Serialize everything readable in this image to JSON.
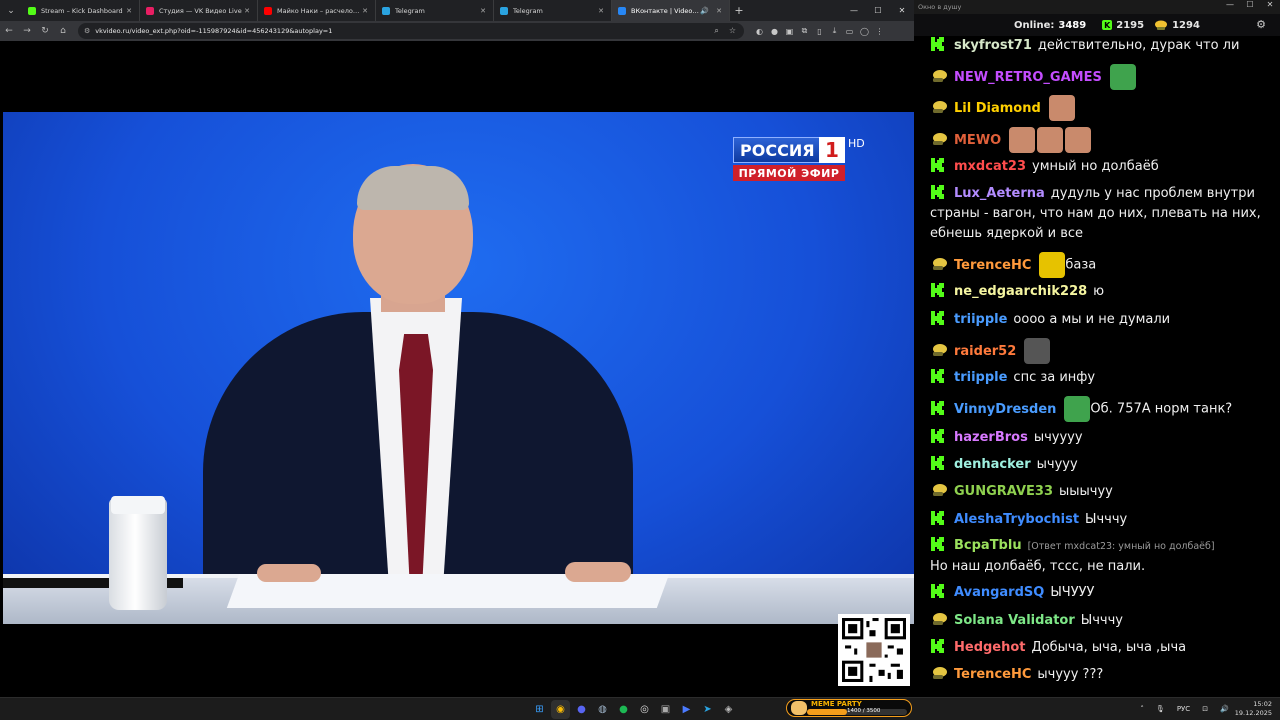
{
  "tabs": [
    {
      "title": "Stream – Kick Dashboard",
      "color": "#53fc18",
      "active": false
    },
    {
      "title": "Студия — VK Видео Live",
      "color": "#e91e63",
      "active": false
    },
    {
      "title": "Майко Наки – расчеловечиваю",
      "color": "#ff0000",
      "active": false
    },
    {
      "title": "Telegram",
      "color": "#2aa3e0",
      "active": false
    },
    {
      "title": "Telegram",
      "color": "#2aa3e0",
      "active": false
    },
    {
      "title": "ВКонтакте | Video Ext",
      "color": "#2787f5",
      "active": true
    }
  ],
  "address_bar": {
    "url": "vkvideo.ru/video_ext.php?oid=-115987924&id=456243129&autoplay=1"
  },
  "video": {
    "channel_name": "РОССИЯ",
    "channel_number": "1",
    "channel_hd": "HD",
    "live_label": "ПРЯМОЙ ЭФИР"
  },
  "chat": {
    "window_title": "Окно в душу",
    "online_label": "Online:",
    "online_count": "3489",
    "kick_count": "2195",
    "vk_count": "1294",
    "messages": [
      {
        "platform": "kick",
        "user": "skyfrost71",
        "color": "#d7e8c9",
        "text": "действительно, дурак что ли",
        "emotes": []
      },
      {
        "platform": "vk",
        "user": "NEW_RETRO_GAMES",
        "color": "#c44dff",
        "text": "",
        "emotes": [
          "pepe"
        ]
      },
      {
        "platform": "vk",
        "user": "Lil Diamond",
        "color": "#ffd000",
        "text": "",
        "emotes": [
          "face"
        ]
      },
      {
        "platform": "vk",
        "user": "MEWO",
        "color": "#e0603a",
        "text": "",
        "emotes": [
          "face",
          "face",
          "face"
        ]
      },
      {
        "platform": "kick",
        "user": "mxdcat23",
        "color": "#ff4d4d",
        "text": "умный но долбаёб",
        "emotes": []
      },
      {
        "platform": "kick",
        "user": "Lux_Aeterna",
        "color": "#b38cff",
        "text": "дудуль у нас проблем внутри страны - вагон, что нам до них, плевать на них, ебнешь ядеркой и все",
        "emotes": []
      },
      {
        "platform": "vk",
        "user": "TerenceHC",
        "color": "#ff9a3c",
        "text": "база",
        "emotes": [
          "pog"
        ]
      },
      {
        "platform": "kick",
        "user": "ne_edgaarchik228",
        "color": "#f5f5a0",
        "text": "ю",
        "emotes": []
      },
      {
        "platform": "kick",
        "user": "triipple",
        "color": "#4a9cff",
        "text": "оооо а мы и не думали",
        "emotes": []
      },
      {
        "platform": "vk",
        "user": "raider52",
        "color": "#ff7a3c",
        "text": "",
        "emotes": [
          "cat"
        ]
      },
      {
        "platform": "kick",
        "user": "triipple",
        "color": "#4a9cff",
        "text": "спс за инфу",
        "emotes": []
      },
      {
        "platform": "kick",
        "user": "VinnyDresden",
        "color": "#4a9cff",
        "text": "Об. 757А норм танк?",
        "emotes": [
          "pepe"
        ]
      },
      {
        "platform": "kick",
        "user": "hazerBros",
        "color": "#d879ff",
        "text": "ычуууу",
        "emotes": []
      },
      {
        "platform": "kick",
        "user": "denhacker",
        "color": "#9ef0e0",
        "text": "ычууу",
        "emotes": []
      },
      {
        "platform": "vk",
        "user": "GUNGRAVE33",
        "color": "#8fd14f",
        "text": "ыыычуу",
        "emotes": []
      },
      {
        "platform": "kick",
        "user": "AleshaTrybochist",
        "color": "#3f8cff",
        "text": "Ычччу",
        "emotes": []
      },
      {
        "platform": "kick",
        "user": "BcpaTblu",
        "color": "#9be15d",
        "text": "Но наш долбаёб, тссс, не пали.",
        "reply": "[Ответ mxdcat23: умный но долбаёб]",
        "emotes": []
      },
      {
        "platform": "kick",
        "user": "AvangardSQ",
        "color": "#3f8cff",
        "text": "ЫЧУУУ",
        "emotes": []
      },
      {
        "platform": "vk",
        "user": "Solana Validator",
        "color": "#7ee787",
        "text": "Ычччу",
        "emotes": []
      },
      {
        "platform": "kick",
        "user": "Hedgehot",
        "color": "#ff6b6b",
        "text": "Добыча, ыча, ыча ,ыча",
        "emotes": []
      },
      {
        "platform": "vk",
        "user": "TerenceHC",
        "color": "#ff9a3c",
        "text": "ычууу ???",
        "emotes": []
      }
    ]
  },
  "taskbar": {
    "meme_title": "MEME PARTY",
    "meme_counter": "1400 / 3500",
    "meme_progress": 0.4,
    "lang": "РУС",
    "time": "15:02",
    "date": "19.12.2025"
  },
  "colors": {
    "kick_green": "#53fc18",
    "rossia_red": "#d0202a",
    "studio_blue": "#1650d8"
  }
}
